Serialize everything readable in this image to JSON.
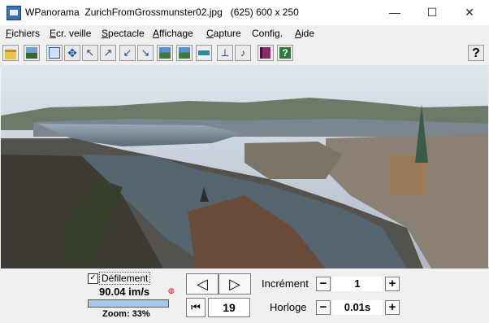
{
  "window": {
    "title": "WPanorama  ZurichFromGrossmunster02.jpg   (625) 600 x 250",
    "minimize_glyph": "—",
    "maximize_glyph": "☐",
    "close_glyph": "✕"
  },
  "menu": [
    {
      "u": "F",
      "rest": "ichiers"
    },
    {
      "u": "E",
      "rest": "cr. veille"
    },
    {
      "u": "S",
      "rest": "pectacle"
    },
    {
      "u": "A",
      "rest": "ffichage"
    },
    {
      "u": "C",
      "rest": "apture"
    },
    {
      "u": "",
      "rest": "Config."
    },
    {
      "u": "A",
      "rest": "ide"
    }
  ],
  "toolbar": {
    "help_label": "?"
  },
  "scroll": {
    "checkbox_mark": "✓",
    "label": "Défilement",
    "speed": "90.04 im/s",
    "zoom": "Zoom: 33%",
    "record_glyph": "◍",
    "prev_glyph": "◁",
    "next_glyph": "▷",
    "first_glyph": "⏮",
    "frame": "19",
    "increment_label": "Incrément",
    "increment_value": "1",
    "clock_label": "Horloge",
    "clock_value": "0.01s",
    "minus": "−",
    "plus": "+"
  },
  "colors": {
    "accent": "#3b6fb6",
    "bar_fill": "#a8c7ec",
    "water": "#6f7f8a"
  }
}
